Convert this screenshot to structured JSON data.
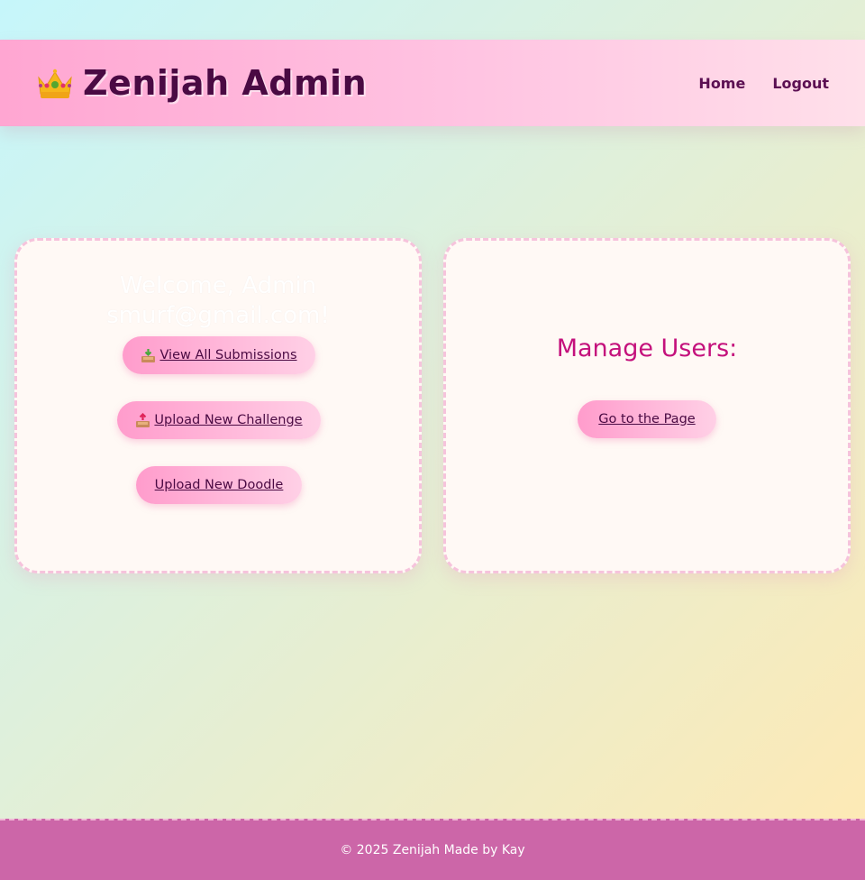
{
  "header": {
    "brand_icon": "crown-icon",
    "title": "Zenijah Admin",
    "nav": {
      "home": "Home",
      "logout": "Logout"
    }
  },
  "admin_panel": {
    "welcome": "Welcome, Admin smurf@gmail.com!",
    "buttons": {
      "view_submissions": {
        "icon": "inbox-tray-icon",
        "label": "View All Submissions"
      },
      "upload_challenge": {
        "icon": "outbox-tray-icon",
        "label": "Upload New Challenge"
      },
      "upload_doodle": {
        "label": "Upload New Doodle"
      }
    }
  },
  "manage_users": {
    "title": "Manage Users:",
    "button": "Go to the Page"
  },
  "footer": {
    "text": "© 2025 Zenijah Made by Kay"
  },
  "colors": {
    "accent": "#ff9ccc",
    "brand_text": "#4a0a43",
    "heading_pink": "#c4117c",
    "footer_bg": "#cc66a8"
  }
}
